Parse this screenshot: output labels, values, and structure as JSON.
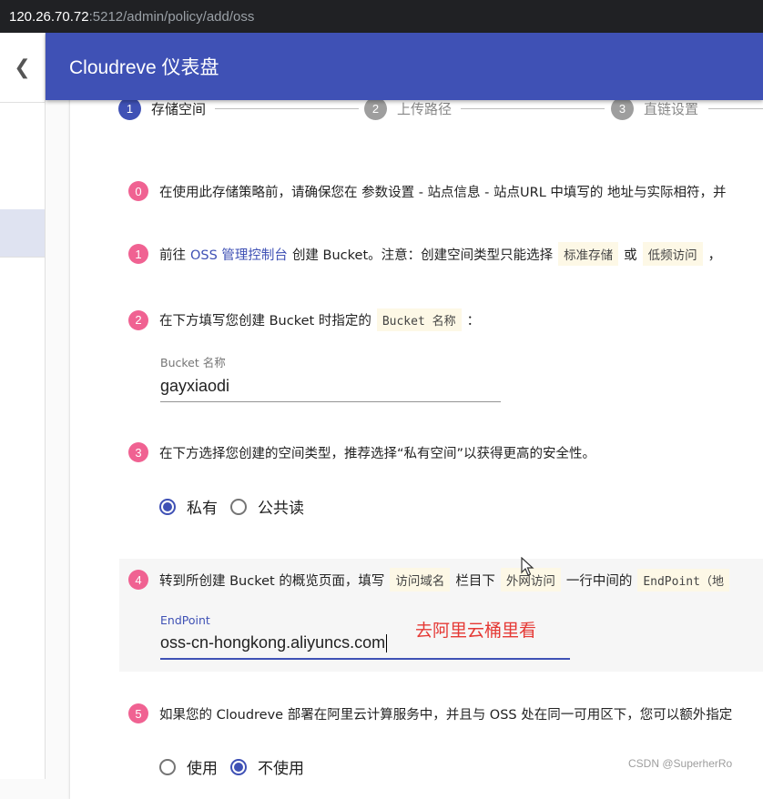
{
  "browser": {
    "url_host": "120.26.70.72",
    "url_path": ":5212/admin/policy/add/oss"
  },
  "appbar": {
    "title": "Cloudreve 仪表盘"
  },
  "drawer": {
    "back_icon": "chevron-left-icon"
  },
  "stepper": [
    {
      "num": "1",
      "label": "存储空间",
      "active": true
    },
    {
      "num": "2",
      "label": "上传路径",
      "active": false
    },
    {
      "num": "3",
      "label": "直链设置",
      "active": false
    }
  ],
  "steps": {
    "s0": {
      "num": "0",
      "text": "在使用此存储策略前，请确保您在 参数设置 - 站点信息 - 站点URL 中填写的 地址与实际相符，并"
    },
    "s1": {
      "num": "1",
      "text_a": "前往",
      "link": "OSS 管理控制台",
      "text_b": "创建 Bucket。注意：创建空间类型只能选择",
      "code_a": "标准存储",
      "text_c": "或",
      "code_b": "低频访问",
      "text_d": "，"
    },
    "s2": {
      "num": "2",
      "text": "在下方填写您创建 Bucket 时指定的",
      "code": "Bucket 名称",
      "text_end": "："
    },
    "s3": {
      "num": "3",
      "text": "在下方选择您创建的空间类型，推荐选择“私有空间”以获得更高的安全性。"
    },
    "s4": {
      "num": "4",
      "text_a": "转到所创建 Bucket 的概览页面，填写",
      "code_a": "访问域名",
      "text_b": "栏目下",
      "code_b": "外网访问",
      "text_c": "一行中间的",
      "code_c": "EndPoint（地"
    },
    "s5": {
      "num": "5",
      "text": "如果您的 Cloudreve 部署在阿里云计算服务中，并且与 OSS 处在同一可用区下，您可以额外指定"
    }
  },
  "bucket_field": {
    "label": "Bucket 名称",
    "value": "gayxiaodi"
  },
  "bucket_type": {
    "options": [
      "私有",
      "公共读"
    ],
    "selected": "私有"
  },
  "endpoint_field": {
    "label": "EndPoint",
    "value": "oss-cn-hongkong.aliyuncs.com"
  },
  "annotation": "去阿里云桶里看",
  "internal_endpoint": {
    "options": [
      "使用",
      "不使用"
    ],
    "selected": "不使用"
  },
  "watermark": "CSDN @SuperherRo",
  "colors": {
    "primary": "#3f51b5",
    "badge": "#f06292",
    "code_bg": "#fdf8e6",
    "annotation": "#e53935"
  }
}
